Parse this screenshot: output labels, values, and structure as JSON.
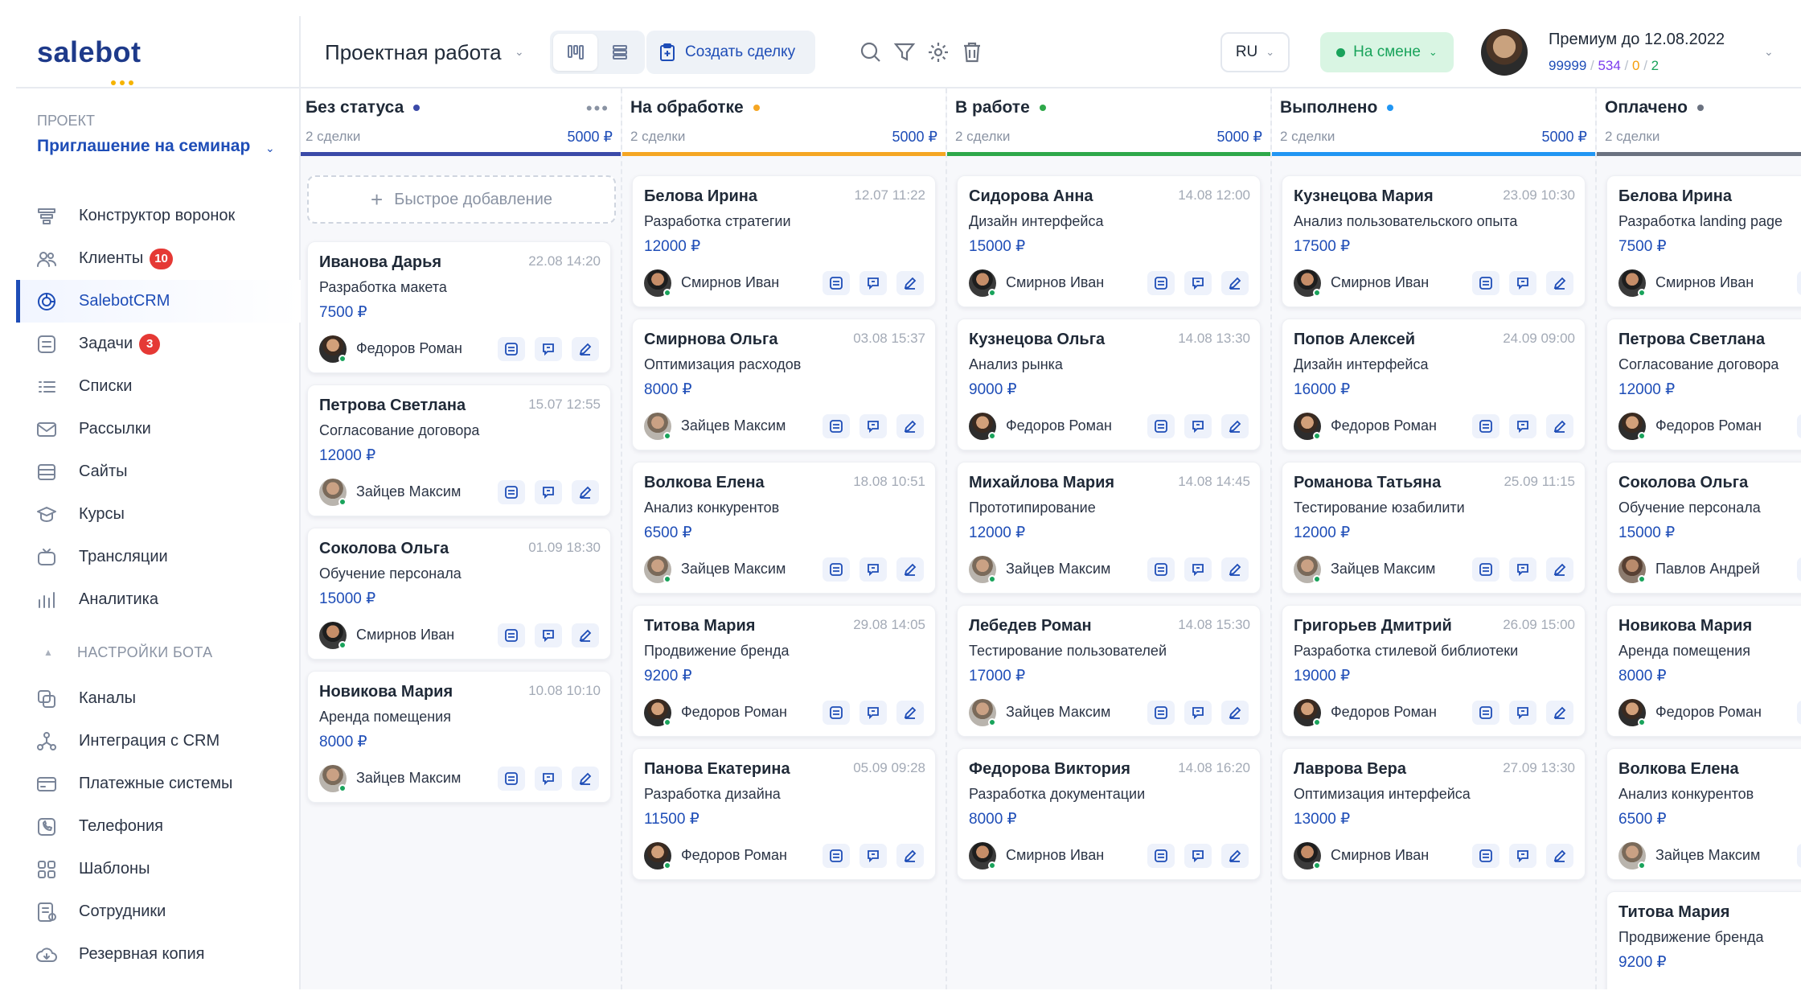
{
  "app": {
    "logo": "salebot"
  },
  "sidebar": {
    "project_label": "ПРОЕКТ",
    "project_name": "Приглашение на семинар",
    "items": [
      {
        "label": "Конструктор воронок",
        "icon": "funnel-builder-icon"
      },
      {
        "label": "Клиенты",
        "icon": "users-icon",
        "badge": "10"
      },
      {
        "label": "SalebotCRM",
        "icon": "crm-icon",
        "active": true
      },
      {
        "label": "Задачи",
        "icon": "tasks-icon",
        "badge": "3"
      },
      {
        "label": "Списки",
        "icon": "list-icon"
      },
      {
        "label": "Рассылки",
        "icon": "mail-icon"
      },
      {
        "label": "Сайты",
        "icon": "sites-icon"
      },
      {
        "label": "Курсы",
        "icon": "courses-icon"
      },
      {
        "label": "Трансляции",
        "icon": "broadcast-icon"
      },
      {
        "label": "Аналитика",
        "icon": "analytics-icon"
      }
    ],
    "settings_title": "НАСТРОЙКИ БОТА",
    "settings_items": [
      {
        "label": "Каналы",
        "icon": "channels-icon"
      },
      {
        "label": "Интеграция с CRM",
        "icon": "integration-icon"
      },
      {
        "label": "Платежные системы",
        "icon": "payment-icon"
      },
      {
        "label": "Телефония",
        "icon": "phone-icon"
      },
      {
        "label": "Шаблоны",
        "icon": "templates-icon"
      },
      {
        "label": "Сотрудники",
        "icon": "employees-icon"
      },
      {
        "label": "Резервная копия",
        "icon": "backup-icon"
      }
    ]
  },
  "topbar": {
    "pipeline": "Проектная работа",
    "create_label": "Создать сделку",
    "lang": "RU",
    "shift": "На смене",
    "premium": "Премиум до 12.08.2022",
    "stats": {
      "a": "99999",
      "b": "534",
      "c": "0",
      "d": "2"
    }
  },
  "colors": {
    "accent": "#1e4db7",
    "green": "#19a35b"
  },
  "board": {
    "quick_add": "Быстрое добавление",
    "columns": [
      {
        "title": "Без статуса",
        "color": "#3b4aa8",
        "count": "2 сделки",
        "sum": "5000 ₽",
        "cards": [
          {
            "name": "Иванова Дарья",
            "date": "22.08 14:20",
            "task": "Разработка макета",
            "price": "7500 ₽",
            "manager": "Федоров Роман",
            "av": "av1"
          },
          {
            "name": "Петрова Светлана",
            "date": "15.07 12:55",
            "task": "Согласование договора",
            "price": "12000 ₽",
            "manager": "Зайцев Максим",
            "av": "av2"
          },
          {
            "name": "Соколова Ольга",
            "date": "01.09 18:30",
            "task": "Обучение персонала",
            "price": "15000 ₽",
            "manager": "Смирнов Иван",
            "av": "av3"
          },
          {
            "name": "Новикова Мария",
            "date": "10.08 10:10",
            "task": "Аренда помещения",
            "price": "8000 ₽",
            "manager": "Зайцев Максим",
            "av": "av2"
          }
        ]
      },
      {
        "title": "На обработке",
        "color": "#f5a623",
        "count": "2 сделки",
        "sum": "5000 ₽",
        "cards": [
          {
            "name": "Белова Ирина",
            "date": "12.07 11:22",
            "task": "Разработка стратегии",
            "price": "12000 ₽",
            "manager": "Смирнов Иван",
            "av": "av3"
          },
          {
            "name": "Смирнова Ольга",
            "date": "03.08 15:37",
            "task": "Оптимизация расходов",
            "price": "8000 ₽",
            "manager": "Зайцев Максим",
            "av": "av2"
          },
          {
            "name": "Волкова Елена",
            "date": "18.08 10:51",
            "task": "Анализ конкурентов",
            "price": "6500 ₽",
            "manager": "Зайцев Максим",
            "av": "av2"
          },
          {
            "name": "Титова Мария",
            "date": "29.08 14:05",
            "task": "Продвижение бренда",
            "price": "9200 ₽",
            "manager": "Федоров Роман",
            "av": "av1"
          },
          {
            "name": "Панова Екатерина",
            "date": "05.09 09:28",
            "task": "Разработка дизайна",
            "price": "11500 ₽",
            "manager": "Федоров Роман",
            "av": "av1"
          }
        ]
      },
      {
        "title": "В работе",
        "color": "#2ea84a",
        "count": "2 сделки",
        "sum": "5000 ₽",
        "cards": [
          {
            "name": "Сидорова Анна",
            "date": "14.08 12:00",
            "task": "Дизайн интерфейса",
            "price": "15000 ₽",
            "manager": "Смирнов Иван",
            "av": "av3"
          },
          {
            "name": "Кузнецова Ольга",
            "date": "14.08 13:30",
            "task": "Анализ рынка",
            "price": "9000 ₽",
            "manager": "Федоров Роман",
            "av": "av1"
          },
          {
            "name": "Михайлова Мария",
            "date": "14.08 14:45",
            "task": "Прототипирование",
            "price": "12000 ₽",
            "manager": "Зайцев Максим",
            "av": "av2"
          },
          {
            "name": "Лебедев Роман",
            "date": "14.08 15:30",
            "task": "Тестирование пользователей",
            "price": "17000 ₽",
            "manager": "Зайцев Максим",
            "av": "av2"
          },
          {
            "name": "Федорова Виктория",
            "date": "14.08 16:20",
            "task": "Разработка документации",
            "price": "8000 ₽",
            "manager": "Смирнов Иван",
            "av": "av3"
          }
        ]
      },
      {
        "title": "Выполнено",
        "color": "#2196f3",
        "count": "2 сделки",
        "sum": "5000 ₽",
        "cards": [
          {
            "name": "Кузнецова Мария",
            "date": "23.09 10:30",
            "task": "Анализ пользовательского опыта",
            "price": "17500 ₽",
            "manager": "Смирнов Иван",
            "av": "av3"
          },
          {
            "name": "Попов Алексей",
            "date": "24.09 09:00",
            "task": "Дизайн интерфейса",
            "price": "16000 ₽",
            "manager": "Федоров Роман",
            "av": "av1"
          },
          {
            "name": "Романова Татьяна",
            "date": "25.09 11:15",
            "task": "Тестирование юзабилити",
            "price": "12000 ₽",
            "manager": "Зайцев Максим",
            "av": "av2"
          },
          {
            "name": "Григорьев Дмитрий",
            "date": "26.09 15:00",
            "task": "Разработка стилевой библиотеки",
            "price": "19000 ₽",
            "manager": "Федоров Роман",
            "av": "av1"
          },
          {
            "name": "Лаврова Вера",
            "date": "27.09 13:30",
            "task": "Оптимизация интерфейса",
            "price": "13000 ₽",
            "manager": "Смирнов Иван",
            "av": "av3"
          }
        ]
      },
      {
        "title": "Оплачено",
        "color": "#6b7280",
        "count": "2 сделки",
        "sum": "",
        "cards": [
          {
            "name": "Белова Ирина",
            "date": "",
            "task": "Разработка landing page",
            "price": "7500 ₽",
            "manager": "Смирнов Иван",
            "av": "av3"
          },
          {
            "name": "Петрова Светлана",
            "date": "",
            "task": "Согласование договора",
            "price": "12000 ₽",
            "manager": "Федоров Роман",
            "av": "av1"
          },
          {
            "name": "Соколова Ольга",
            "date": "",
            "task": "Обучение персонала",
            "price": "15000 ₽",
            "manager": "Павлов Андрей",
            "av": "av4"
          },
          {
            "name": "Новикова Мария",
            "date": "",
            "task": "Аренда помещения",
            "price": "8000 ₽",
            "manager": "Федоров Роман",
            "av": "av1"
          },
          {
            "name": "Волкова Елена",
            "date": "",
            "task": "Анализ конкурентов",
            "price": "6500 ₽",
            "manager": "Зайцев Максим",
            "av": "av2"
          },
          {
            "name": "Титова Мария",
            "date": "",
            "task": "Продвижение бренда",
            "price": "9200 ₽",
            "manager": "",
            "av": ""
          }
        ]
      }
    ]
  }
}
